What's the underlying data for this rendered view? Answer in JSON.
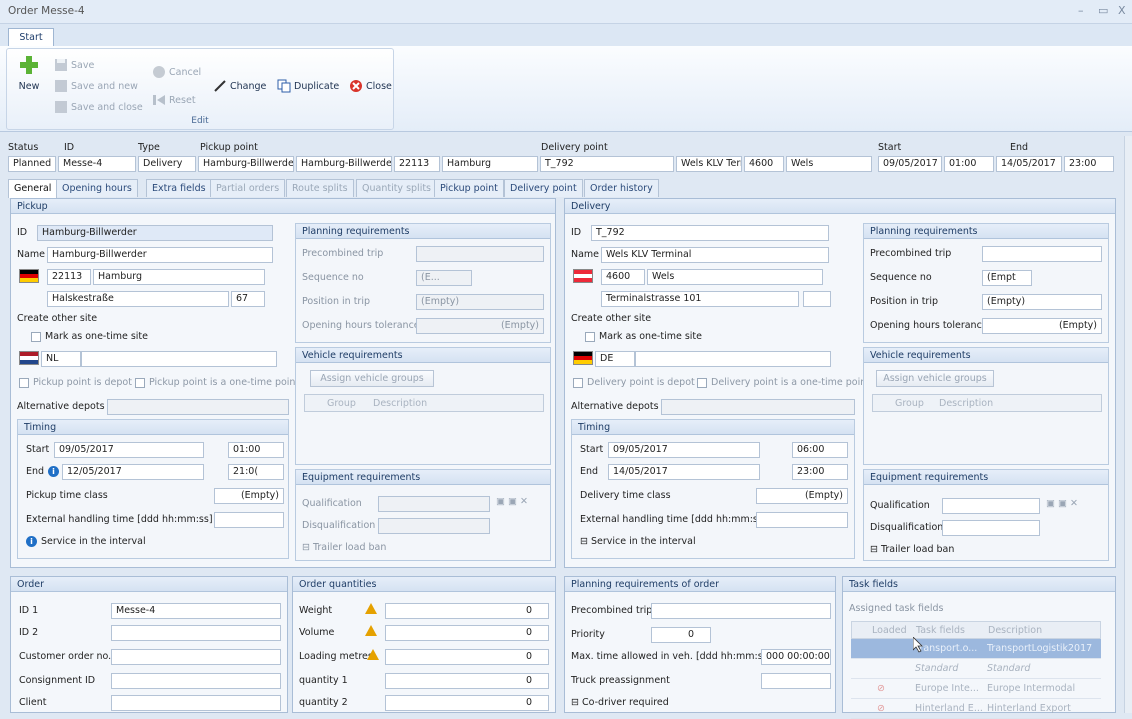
{
  "window": {
    "title": "Order Messe-4",
    "min": "–",
    "max": "▭",
    "close": "X"
  },
  "ribbon": {
    "tab": "Start",
    "new": "New",
    "save": "Save",
    "save_and_new": "Save and new",
    "save_and_close": "Save and close",
    "cancel": "Cancel",
    "reset": "Reset",
    "change": "Change",
    "duplicate": "Duplicate",
    "close": "Close",
    "group": "Edit"
  },
  "header": {
    "labels": {
      "status": "Status",
      "id": "ID",
      "type": "Type",
      "pickup": "Pickup point",
      "delivery": "Delivery point",
      "start": "Start",
      "end": "End"
    },
    "status": "Planned",
    "id": "Messe-4",
    "type": "Delivery",
    "pickup_id": "Hamburg-Billwerder",
    "pickup_name": "Hamburg-Billwerder",
    "pickup_zip": "22113",
    "pickup_city": "Hamburg",
    "delivery_id": "T_792",
    "delivery_name": "Wels KLV Terminal",
    "delivery_zip": "4600",
    "delivery_city": "Wels",
    "start_date": "09/05/2017",
    "start_time": "01:00",
    "end_date": "14/05/2017",
    "end_time": "23:00"
  },
  "tabs": [
    "General",
    "Opening hours",
    "Extra fields",
    "Partial orders",
    "Route splits",
    "Quantity splits",
    "Pickup point",
    "Delivery point",
    "Order history"
  ],
  "pickup": {
    "title": "Pickup",
    "id_label": "ID",
    "id": "Hamburg-Billwerder",
    "name_label": "Name",
    "name": "Hamburg-Billwerder",
    "zip": "22113",
    "city": "Hamburg",
    "street": "Halskestraße",
    "number": "67",
    "create_other": "Create other site",
    "one_time": "Mark as one-time site",
    "country": "NL",
    "is_depot": "Pickup point is depot",
    "is_one_time": "Pickup point is a one-time point",
    "alt_depots": "Alternative depots",
    "timing": "Timing",
    "start_label": "Start",
    "start_date": "09/05/2017",
    "start_time": "01:00",
    "end_label": "End",
    "end_date": "12/05/2017",
    "end_time": "21:0(",
    "time_class": "Pickup time class",
    "time_class_val": "(Empty)",
    "ext_handling": "External handling time [ddd hh:mm:ss]",
    "service": "Service in the interval"
  },
  "pickup_req": {
    "planning": "Planning requirements",
    "precombined": "Precombined trip",
    "seq": "Sequence no",
    "seq_val": "(E...",
    "position": "Position in trip",
    "position_val": "(Empty)",
    "tolerance": "Opening hours tolerance",
    "tolerance_val": "(Empty)",
    "vehicle": "Vehicle requirements",
    "assign": "Assign vehicle groups",
    "group_col": "Group",
    "desc_col": "Description",
    "equipment": "Equipment requirements",
    "qual": "Qualification",
    "disqual": "Disqualification",
    "trailer": "Trailer load ban"
  },
  "delivery": {
    "title": "Delivery",
    "id_label": "ID",
    "id": "T_792",
    "name_label": "Name",
    "name": "Wels KLV Terminal",
    "zip": "4600",
    "city": "Wels",
    "street": "Terminalstrasse 101",
    "create_other": "Create other site",
    "one_time": "Mark as one-time site",
    "country": "DE",
    "is_depot": "Delivery point is depot",
    "is_one_time": "Delivery point is a one-time point",
    "alt_depots": "Alternative depots",
    "timing": "Timing",
    "start_label": "Start",
    "start_date": "09/05/2017",
    "start_time": "06:00",
    "end_label": "End",
    "end_date": "14/05/2017",
    "end_time": "23:00",
    "time_class": "Delivery time class",
    "time_class_val": "(Empty)",
    "ext_handling": "External handling time [ddd hh:mm:ss]",
    "service": "Service in the interval"
  },
  "delivery_req": {
    "planning": "Planning requirements",
    "precombined": "Precombined trip",
    "seq": "Sequence no",
    "seq_val": "(Empt",
    "position": "Position in trip",
    "position_val": "(Empty)",
    "tolerance": "Opening hours tolerance",
    "tolerance_val": "(Empty)",
    "vehicle": "Vehicle requirements",
    "assign": "Assign vehicle groups",
    "group_col": "Group",
    "desc_col": "Description",
    "equipment": "Equipment requirements",
    "qual": "Qualification",
    "disqual": "Disqualification",
    "trailer": "Trailer load ban"
  },
  "order": {
    "title": "Order",
    "id1": "ID 1",
    "id1_val": "Messe-4",
    "id2": "ID 2",
    "customer": "Customer order no.",
    "consignment": "Consignment ID",
    "client": "Client"
  },
  "quantities": {
    "title": "Order quantities",
    "rows": [
      {
        "label": "Weight",
        "value": "0"
      },
      {
        "label": "Volume",
        "value": "0"
      },
      {
        "label": "Loading metres",
        "value": "0"
      },
      {
        "label": "quantity 1",
        "value": "0"
      },
      {
        "label": "quantity 2",
        "value": "0"
      }
    ]
  },
  "order_planning": {
    "title": "Planning requirements of order",
    "precombined": "Precombined trip",
    "priority": "Priority",
    "priority_val": "0",
    "max_time": "Max. time allowed in veh. [ddd hh:mm:ss]",
    "max_time_val": "000 00:00:00",
    "truck": "Truck preassignment",
    "codriver": "Co-driver required"
  },
  "task_fields": {
    "title": "Task fields",
    "assigned": "Assigned task fields",
    "cols": [
      "Loaded",
      "Task fields",
      "Description"
    ],
    "rows": [
      {
        "task": "Transport.o...",
        "desc": "TransportLogistik2017"
      },
      {
        "task": "Standard",
        "desc": "Standard"
      },
      {
        "task": "Europe Inte...",
        "desc": "Europe Intermodal"
      },
      {
        "task": "Hinterland E...",
        "desc": "Hinterland Export"
      }
    ]
  }
}
